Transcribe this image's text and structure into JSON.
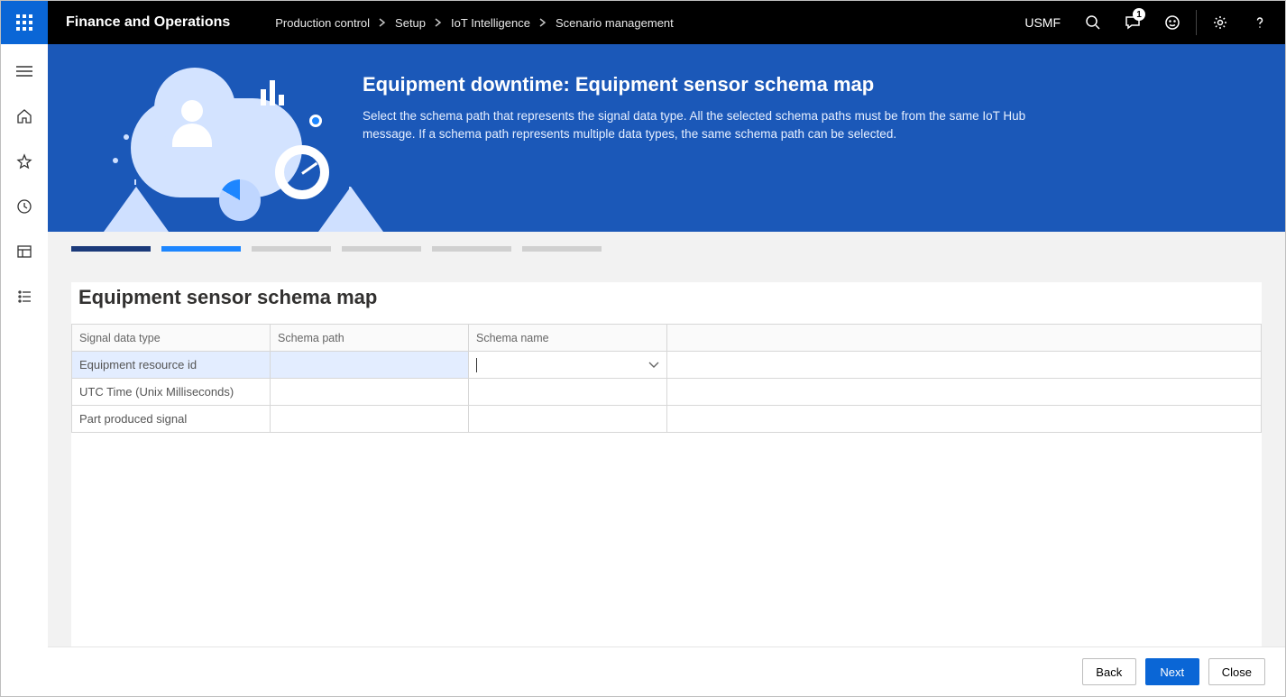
{
  "app_title": "Finance and Operations",
  "legal_entity": "USMF",
  "notification_count": "1",
  "breadcrumbs": [
    "Production control",
    "Setup",
    "IoT Intelligence",
    "Scenario management"
  ],
  "hero": {
    "title": "Equipment downtime: Equipment sensor schema map",
    "description": "Select the schema path that represents the signal data type. All the selected schema paths must be from the same IoT Hub message. If a schema path represents multiple data types, the same schema path can be selected."
  },
  "steps": {
    "total": 6,
    "done": 1,
    "current": 2
  },
  "card": {
    "title": "Equipment sensor schema map",
    "columns": [
      "Signal data type",
      "Schema path",
      "Schema name"
    ],
    "rows": [
      {
        "signal": "Equipment resource id",
        "path": "",
        "name": "",
        "active": true
      },
      {
        "signal": "UTC Time (Unix Milliseconds)",
        "path": "",
        "name": "",
        "active": false
      },
      {
        "signal": "Part produced signal",
        "path": "",
        "name": "",
        "active": false
      }
    ]
  },
  "footer": {
    "back": "Back",
    "next": "Next",
    "close": "Close"
  }
}
